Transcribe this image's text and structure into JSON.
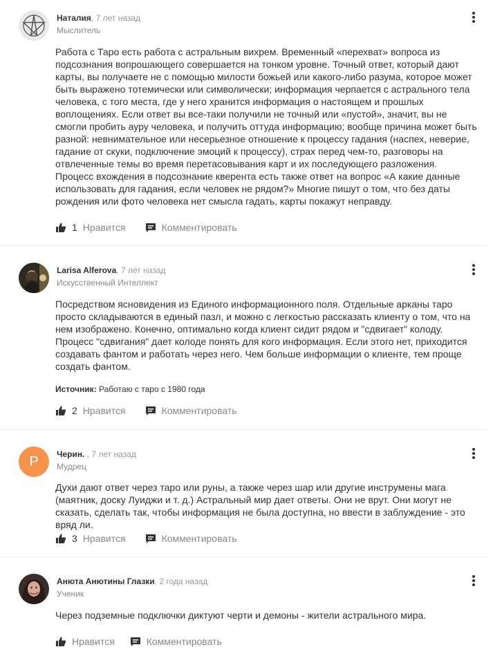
{
  "answers": [
    {
      "author": "Наталия",
      "time": ", 7 лет назад",
      "rank": "Мыслитель",
      "text": "Работа с Таро есть работа с астральным вихрем. Временный «перехват» вопроса из подсознания вопрошающего совершается на тонком уровне. Точный ответ, который дают карты, вы получаете не с помощью милости божьей или какого-либо разума, которое может быть выражено тотемически или символически; информация черпается с астрального тела человека, с того места, где у него хранится информация о настоящем и прошлых воплощениях. Если ответ вы все-таки получили не точный или «пустой», значит, вы не смогли пробить ауру человека, и получить оттуда информацию; вообще причина может быть разной: невнимательное или несерьезное отношение к процессу гадания (наспех, неверие, гадание от скуки, подключение эмоций к процессу), страх перед чем-то, разговоры на отвлеченные темы во время перетасовывания карт и их последующего разложения.\nПроцесс вхождения в подсознание кверента есть также ответ на вопрос «А какие данные использовать для гадания, если человек не рядом?» Многие пишут о том, что без даты рождения или фото человека нет смысла гадать, карты покажут неправду.",
      "likes": "1",
      "like_label": "Нравится",
      "comment_label": "Комментировать"
    },
    {
      "author": "Larisa Alferova",
      "time": ", 7 лет назад",
      "rank": "Искусственный Интеллект",
      "text": "Посредством ясновидения из Единого информационного поля. Отдельные арканы таро просто складываются в единый пазл, и можно с легкостью рассказать клиенту о том, что на нем изображено. Конечно, оптимально когда клиент сидит рядом и \"сдвигает\" колоду. Процесс \"сдвигания\" дает колоде понять для кого информация. Если этого нет, приходится создавать фантом и работать через него. Чем больше информации о клиенте, тем проще создать фантом.",
      "source_label": "Источник:",
      "source_text": " Работаю с таро с 1980 года",
      "likes": "2",
      "like_label": "Нравится",
      "comment_label": "Комментировать"
    },
    {
      "author": "Черин.",
      "time": " , 7 лет назад",
      "rank": "Мудрец",
      "avatar_letter": "Р",
      "text": "Духи дают ответ через таро или руны, а также через шар или другие инструмены мага (маятник, доску Луиджи и т. д.) Астральный мир дает ответы. Они не врут. Они могут не сказать, сделать так, чтобы информация не была доступна, но ввести в заблуждение - это вряд ли.",
      "likes": "3",
      "like_label": "Нравится",
      "comment_label": "Комментировать"
    },
    {
      "author": "Анюта Анютины Глазки",
      "time": ", 2 года назад",
      "rank": "Ученик",
      "text": "Через подземные подключки диктуют черти и демоны - жители астрального мира.",
      "like_label": "Нравится",
      "comment_label": "Комментировать"
    }
  ],
  "colors": {
    "avatar_letter_bg": "#f7934c",
    "text": "#333333",
    "muted": "#999999"
  }
}
